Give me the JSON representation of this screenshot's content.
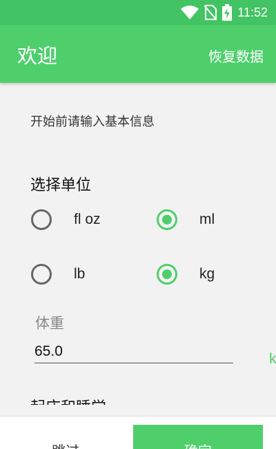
{
  "status_bar": {
    "time": "11:52",
    "icons": [
      "wifi-icon",
      "no-sim-icon",
      "battery-charging-icon"
    ]
  },
  "app_bar": {
    "title": "欢迎",
    "action_label": "恢复数据"
  },
  "content": {
    "intro": "开始前请输入基本信息",
    "unit_section_title": "选择单位",
    "volume_units": [
      {
        "label": "fl oz",
        "checked": false
      },
      {
        "label": "ml",
        "checked": true
      }
    ],
    "weight_units": [
      {
        "label": "lb",
        "checked": false
      },
      {
        "label": "kg",
        "checked": true
      }
    ],
    "weight_field": {
      "label": "体重",
      "value": "65.0",
      "unit_suffix": "k"
    },
    "next_section_title": "起床和睡觉"
  },
  "bottom_bar": {
    "skip_label": "跳过",
    "confirm_label": "确定"
  },
  "colors": {
    "accent": "#4fcf6c",
    "status_bar": "#43c464",
    "background": "#f2f2f2"
  }
}
